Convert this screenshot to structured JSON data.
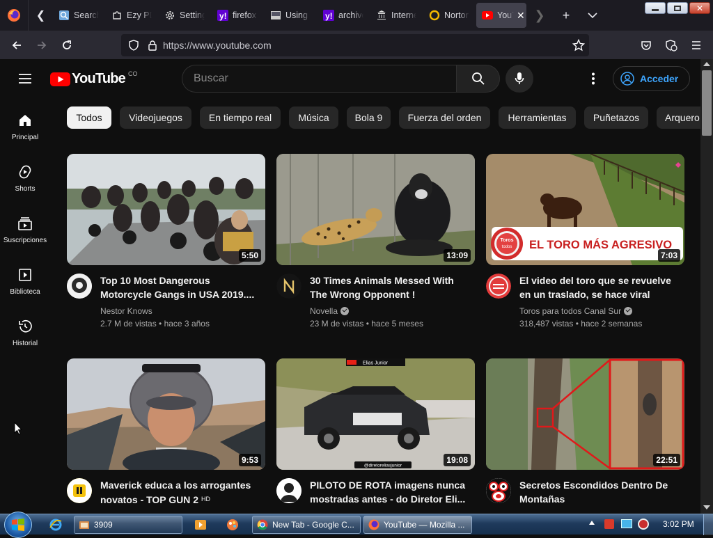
{
  "browser": {
    "tabs": [
      {
        "label": "Search",
        "icon": "search-page-icon"
      },
      {
        "label": "Ezy PDF",
        "icon": "puzzle-icon"
      },
      {
        "label": "Settings",
        "icon": "gear-icon"
      },
      {
        "label": "firefox",
        "icon": "yahoo-icon"
      },
      {
        "label": "Using",
        "icon": "page-icon"
      },
      {
        "label": "archive",
        "icon": "yahoo-icon"
      },
      {
        "label": "Internet",
        "icon": "archive-icon"
      },
      {
        "label": "Norton",
        "icon": "norton-icon"
      },
      {
        "label": "YouTube",
        "icon": "youtube-icon",
        "active": true
      }
    ],
    "url": "https://www.youtube.com"
  },
  "youtube": {
    "logo_text": "YouTube",
    "country_code": "CO",
    "search_placeholder": "Buscar",
    "signin_label": "Acceder",
    "guide": [
      {
        "label": "Principal",
        "icon": "home-icon"
      },
      {
        "label": "Shorts",
        "icon": "shorts-icon"
      },
      {
        "label": "Suscripciones",
        "icon": "subscriptions-icon"
      },
      {
        "label": "Biblioteca",
        "icon": "library-icon"
      },
      {
        "label": "Historial",
        "icon": "history-icon"
      }
    ],
    "chips": [
      "Todos",
      "Videojuegos",
      "En tiempo real",
      "Música",
      "Bola 9",
      "Fuerza del orden",
      "Herramientas",
      "Puñetazos",
      "Arquero"
    ],
    "videos": [
      {
        "title": "Top 10 Most Dangerous Motorcycle Gangs in USA 2019....",
        "channel": "Nestor Knows",
        "verified": false,
        "views": "2.7 M de vistas",
        "age": "hace 3 años",
        "duration": "5:50"
      },
      {
        "title": "30 Times Animals Messed With The Wrong Opponent !",
        "channel": "Novella",
        "verified": true,
        "views": "23 M de vistas",
        "age": "hace 5 meses",
        "duration": "13:09"
      },
      {
        "title": "El video del toro que se revuelve en un traslado, se hace viral",
        "channel": "Toros para todos Canal Sur",
        "verified": true,
        "views": "318,487 vistas",
        "age": "hace 2 semanas",
        "duration": "7:03",
        "thumb_caption": "EL TORO MÁS AGRESIVO",
        "thumb_badge": "Toros para todos"
      },
      {
        "title": "Maverick educa a los arrogantes novatos - TOP GUN 2",
        "hd": "HD",
        "duration": "9:53"
      },
      {
        "title": "PILOTO DE ROTA imagens nunca mostradas antes - do Diretor Eli...",
        "duration": "19:08",
        "thumb_top": "Elias Junior",
        "thumb_bottom": "@diretoreliasjunior"
      },
      {
        "title": "Secretos Escondidos Dentro De Montañas",
        "duration": "22:51"
      }
    ]
  },
  "taskbar": {
    "tasks": [
      {
        "label": "3909"
      },
      {
        "label": "New Tab - Google C..."
      },
      {
        "label": "YouTube — Mozilla ..."
      }
    ],
    "clock": "3:02 PM"
  },
  "colors": {
    "yt_red": "#ff0000",
    "link_blue": "#3ea6ff",
    "bg": "#0f0f0f"
  }
}
